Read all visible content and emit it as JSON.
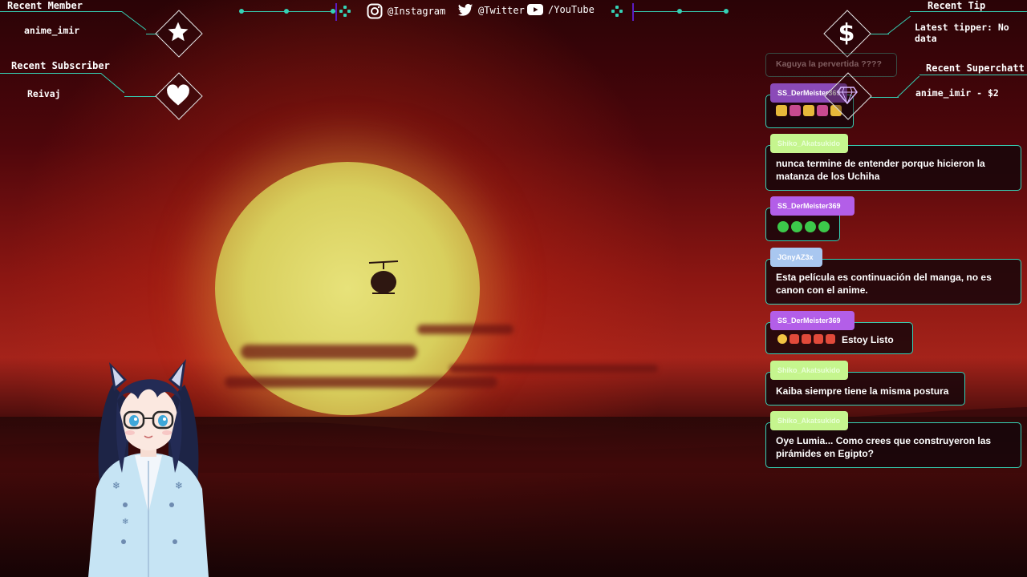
{
  "social": {
    "instagram": "@Instagram",
    "twitter": "@Twitter",
    "youtube": "/YouTube"
  },
  "alerts": {
    "recent_member": {
      "title": "Recent Member",
      "value": "anime_imir"
    },
    "recent_subscriber": {
      "title": "Recent Subscriber",
      "value": "Reivaj"
    },
    "recent_tip": {
      "title": "Recent Tip",
      "value": "Latest tipper: No data"
    },
    "recent_superchat": {
      "title": "Recent Superchatt",
      "value": "anime_imir - $2"
    }
  },
  "chat": {
    "faded_message": "Kaguya la pervertida ????",
    "messages": [
      {
        "user": "SS_DerMeister369",
        "text": ""
      },
      {
        "user": "Shiko_Akatsukido",
        "text": "nunca termine de entender porque hicieron la matanza de los Uchiha"
      },
      {
        "user": "SS_DerMeister369",
        "text": ""
      },
      {
        "user": "JGnyAZ3x",
        "text": "Esta película es continuación del manga, no es canon con el anime."
      },
      {
        "user": "SS_DerMeister369",
        "text": "Estoy Listo"
      },
      {
        "user": "Shiko_Akatsukido",
        "text": "Kaiba siempre tiene la misma postura"
      },
      {
        "user": "Shiko_Akatsukido",
        "text": "Oye Lumia... Como crees que construyeron las pirámides en Egipto?"
      }
    ]
  },
  "colors": {
    "accent": "#35d1b5",
    "tag_purple": "#b35ee8",
    "tag_green": "#c5f58e",
    "tag_blue": "#a9c7f0"
  }
}
